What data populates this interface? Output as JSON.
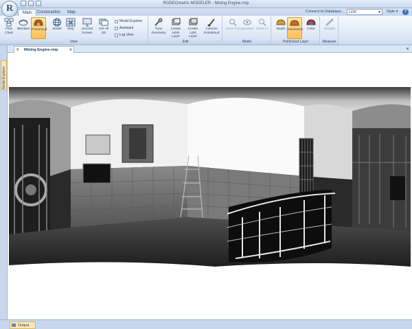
{
  "app": {
    "title": "RODEOmetric MODELER - Mining Engine.rmp",
    "logo_letter": "R"
  },
  "tabs": [
    {
      "label": "Main",
      "active": true
    },
    {
      "label": "Construction",
      "active": false
    },
    {
      "label": "Map",
      "active": false
    }
  ],
  "topright": {
    "connect_label": "Connect to Database...",
    "view_mode_value": "LDR",
    "style_label": "Style"
  },
  "ribbon": {
    "view_group": {
      "label": "View",
      "buttons": [
        "Flow Chart",
        "Blended",
        "Pointcloud",
        "Model",
        "Map",
        "Second Screen",
        "VIS-All 3D"
      ],
      "checkboxes": [
        "Model Explorer",
        "Assistant",
        "Log View"
      ]
    },
    "edit_group": {
      "label": "Edit",
      "buttons": [
        "Tune Geometry",
        "Create HDR Layer",
        "Create LDR Layer",
        "Colorize Pointcloud"
      ]
    },
    "model_group": {
      "label": "Model",
      "buttons": [
        "Zoom Out",
        "Standard",
        "Zoom In"
      ]
    },
    "pointcloud_group": {
      "label": "Pointcloud Layer",
      "buttons": [
        "Depth",
        "Remission",
        "Color"
      ]
    },
    "measure_group": {
      "label": "Measure",
      "buttons": [
        "Straight"
      ]
    }
  },
  "document": {
    "tab_label": "Mining Engine.rmp"
  },
  "side": {
    "panel_label": "Model Explorer"
  },
  "bottom": {
    "output_label": "Output"
  },
  "colors": {
    "active_button": "#ffbf55",
    "ribbon_bg": "#dde8f6",
    "frame": "#c5d3e6"
  }
}
